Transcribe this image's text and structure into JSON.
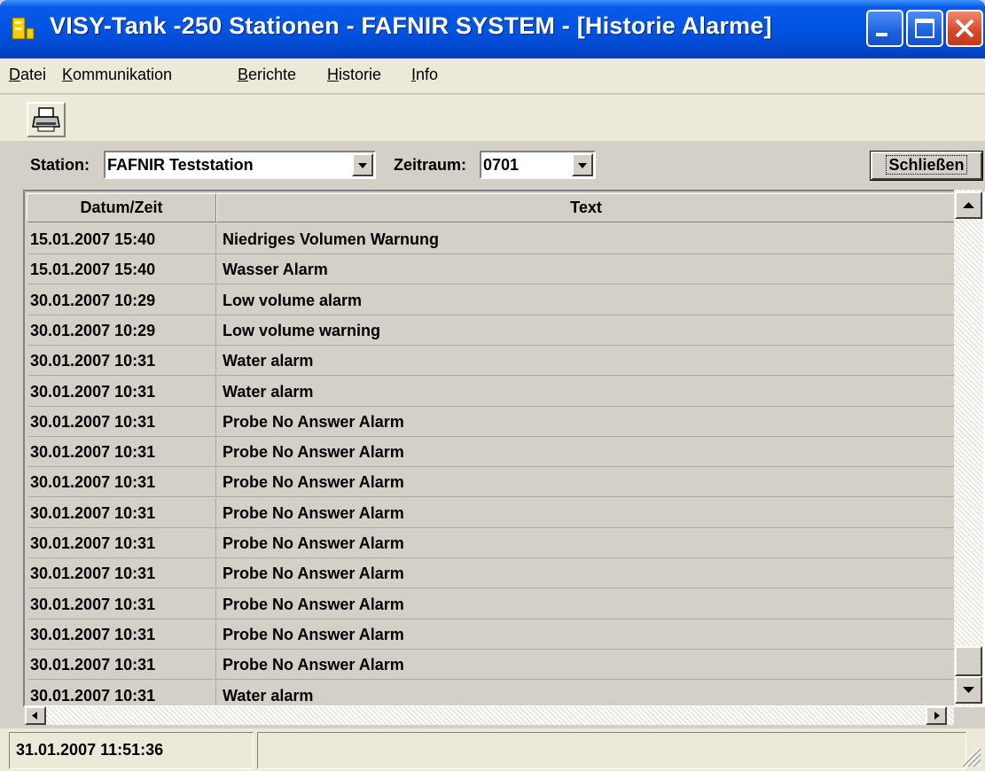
{
  "window": {
    "title": "VISY-Tank -250 Stationen - FAFNIR SYSTEM - [Historie Alarme]",
    "title_color": "#ffffff",
    "titlebar_color": "#0054e3"
  },
  "menu": {
    "items": [
      {
        "label": "Datei",
        "accel": "D"
      },
      {
        "label": "Kommunikation",
        "accel": "K"
      },
      {
        "label": "Berichte",
        "accel": "B"
      },
      {
        "label": "Historie",
        "accel": "H"
      },
      {
        "label": "Info",
        "accel": "I"
      }
    ]
  },
  "toolbar": {
    "print_icon": "printer-icon"
  },
  "filters": {
    "station_label": "Station:",
    "station_value": "FAFNIR Teststation",
    "period_label": "Zeitraum:",
    "period_value": "0701",
    "close_label": "Schließen"
  },
  "table": {
    "columns": [
      "Datum/Zeit",
      "Text"
    ],
    "rows": [
      {
        "datetime": "15.01.2007 15:40",
        "text": "Niedriges Volumen Warnung"
      },
      {
        "datetime": "15.01.2007 15:40",
        "text": "Wasser Alarm"
      },
      {
        "datetime": "30.01.2007 10:29",
        "text": "Low volume alarm"
      },
      {
        "datetime": "30.01.2007 10:29",
        "text": "Low volume warning"
      },
      {
        "datetime": "30.01.2007 10:31",
        "text": "Water alarm"
      },
      {
        "datetime": "30.01.2007 10:31",
        "text": "Water alarm"
      },
      {
        "datetime": "30.01.2007 10:31",
        "text": "Probe No Answer Alarm"
      },
      {
        "datetime": "30.01.2007 10:31",
        "text": "Probe No Answer Alarm"
      },
      {
        "datetime": "30.01.2007 10:31",
        "text": "Probe No Answer Alarm"
      },
      {
        "datetime": "30.01.2007 10:31",
        "text": "Probe No Answer Alarm"
      },
      {
        "datetime": "30.01.2007 10:31",
        "text": "Probe No Answer Alarm"
      },
      {
        "datetime": "30.01.2007 10:31",
        "text": "Probe No Answer Alarm"
      },
      {
        "datetime": "30.01.2007 10:31",
        "text": "Probe No Answer Alarm"
      },
      {
        "datetime": "30.01.2007 10:31",
        "text": "Probe No Answer Alarm"
      },
      {
        "datetime": "30.01.2007 10:31",
        "text": "Probe No Answer Alarm"
      },
      {
        "datetime": "30.01.2007 10:31",
        "text": "Water alarm"
      }
    ]
  },
  "status": {
    "datetime": "31.01.2007 11:51:36"
  }
}
